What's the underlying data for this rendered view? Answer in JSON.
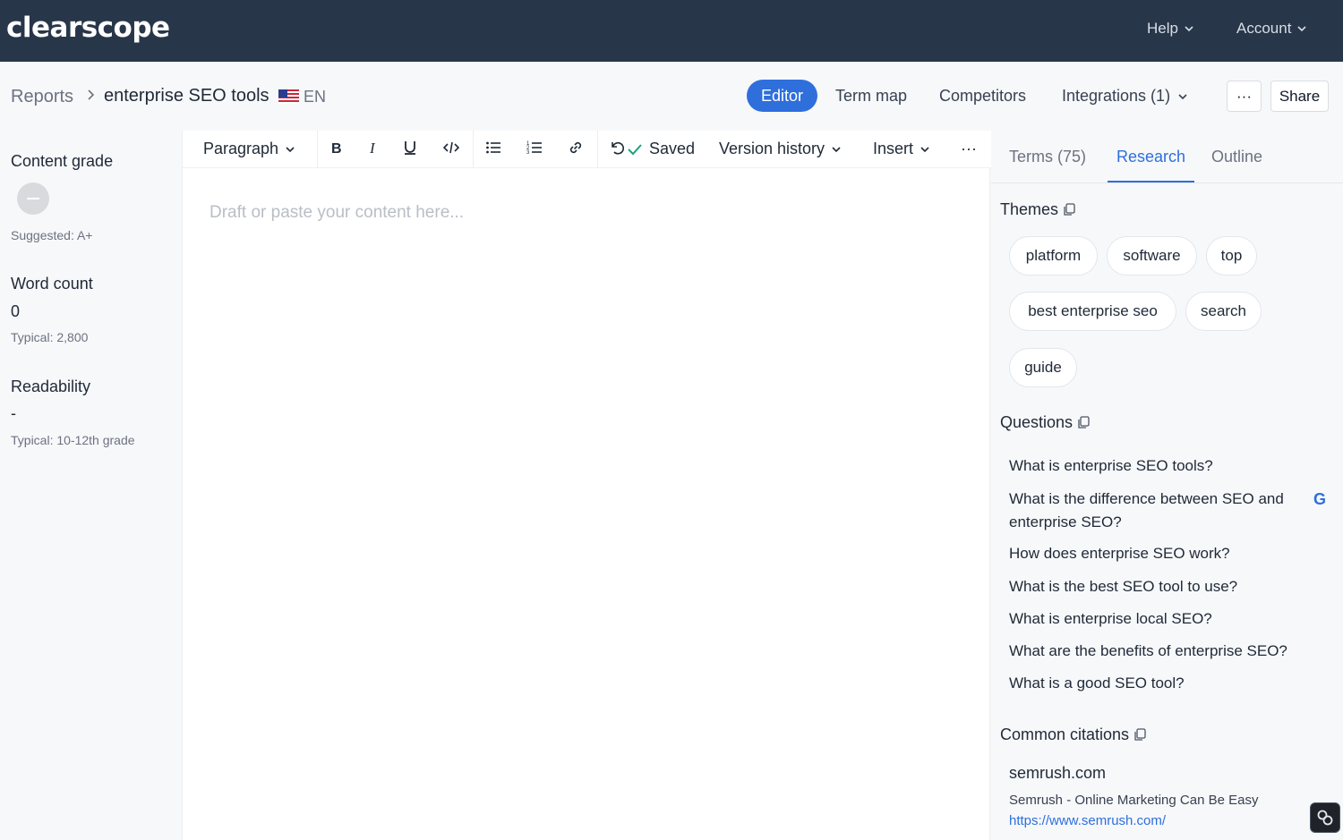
{
  "app": {
    "logo": "clearscope"
  },
  "topnav": {
    "help": "Help",
    "account": "Account"
  },
  "breadcrumb": {
    "reports": "Reports",
    "title": "enterprise SEO tools",
    "lang": "EN"
  },
  "header_nav": {
    "editor": "Editor",
    "term_map": "Term map",
    "competitors": "Competitors",
    "integrations": "Integrations (1)",
    "more": "···",
    "share": "Share"
  },
  "metrics": {
    "content_grade": {
      "label": "Content grade",
      "suggested": "Suggested: A+"
    },
    "word_count": {
      "label": "Word count",
      "value": "0",
      "typical": "Typical: 2,800"
    },
    "readability": {
      "label": "Readability",
      "value": "-",
      "typical": "Typical: 10-12th grade"
    }
  },
  "toolbar": {
    "paragraph": "Paragraph",
    "saved": "Saved",
    "version_history": "Version history",
    "insert": "Insert",
    "more": "···"
  },
  "editor": {
    "placeholder": "Draft or paste your content here..."
  },
  "panel": {
    "tabs": {
      "terms": "Terms (75)",
      "research": "Research",
      "outline": "Outline"
    },
    "themes_title": "Themes",
    "themes": [
      "platform",
      "software",
      "top",
      "best enterprise seo",
      "search",
      "guide"
    ],
    "questions_title": "Questions",
    "questions": [
      "What is enterprise SEO tools?",
      "What is the difference between SEO and enterprise SEO?",
      "How does enterprise SEO work?",
      "What is the best SEO tool to use?",
      "What is enterprise local SEO?",
      "What are the benefits of enterprise SEO?",
      "What is a good SEO tool?"
    ],
    "google_mark": "G",
    "citations_title": "Common citations",
    "citation": {
      "domain": "semrush.com",
      "title": "Semrush - Online Marketing Can Be Easy",
      "url": "https://www.semrush.com/"
    }
  },
  "colors": {
    "topbar": "#283649",
    "accent": "#2e6fdc",
    "page_bg": "#f7f8fa"
  }
}
